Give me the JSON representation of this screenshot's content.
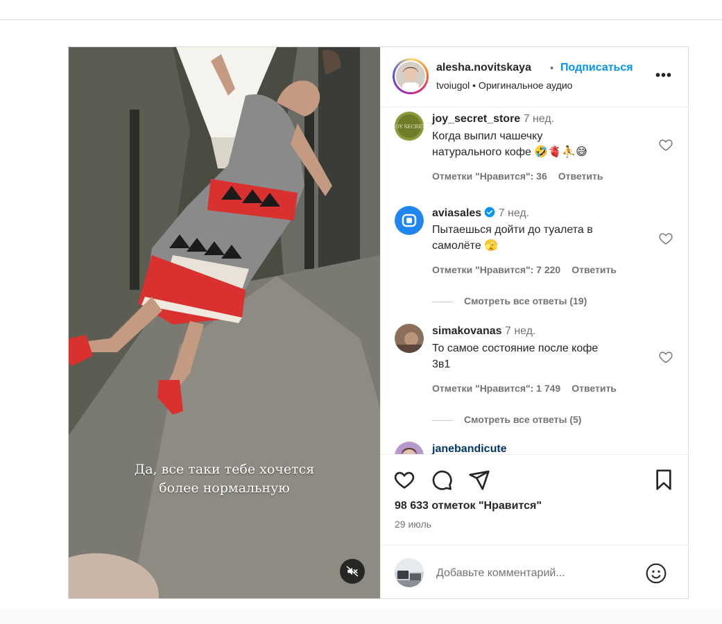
{
  "post": {
    "caption_lines": [
      "Да, все таки тебе хочется",
      "более нормальную"
    ],
    "mute_icon": "speaker-muted-icon"
  },
  "header": {
    "username": "alesha.novitskaya",
    "separator": "•",
    "follow_label": "Подписаться",
    "audio": "tvoiugol • Оригинальное аудио",
    "more_icon": "more-horizontal-icon",
    "more_label": "•••"
  },
  "comments": [
    {
      "user": "joy_secret_store",
      "time": "7 нед.",
      "text_lines": [
        "Когда выпил чашечку",
        "натурального кофе 🤣🫀⛹😅"
      ],
      "likes": "Отметки \"Нравится\": 36",
      "reply": "Ответить",
      "avatar_text": "JOY SECRET"
    },
    {
      "user": "aviasales",
      "verified": true,
      "time": "7 нед.",
      "text_lines": [
        "Пытаешься дойти до туалета в",
        "самолёте 🫣"
      ],
      "likes": "Отметки \"Нравится\": 7 220",
      "reply": "Ответить",
      "view_replies": "Смотреть все ответы (19)"
    },
    {
      "user": "simakovanas",
      "time": "7 нед.",
      "text_lines": [
        "То самое состояние после кофе",
        "3в1"
      ],
      "likes": "Отметки \"Нравится\": 1 749",
      "reply": "Ответить",
      "view_replies": "Смотреть все ответы (5)"
    },
    {
      "user": "janebandicute"
    }
  ],
  "actions": {
    "like_icon": "heart-icon",
    "comment_icon": "comment-bubble-icon",
    "share_icon": "paper-plane-icon",
    "save_icon": "bookmark-icon",
    "likes_count": "98 633 отметок \"Нравится\"",
    "date": "29 июль"
  },
  "add_comment": {
    "placeholder": "Добавьте комментарий...",
    "emoji_icon": "smiley-icon"
  },
  "colors": {
    "accent": "#0095f6",
    "text": "#262626",
    "muted": "#737373",
    "border": "#dbdbdb"
  }
}
